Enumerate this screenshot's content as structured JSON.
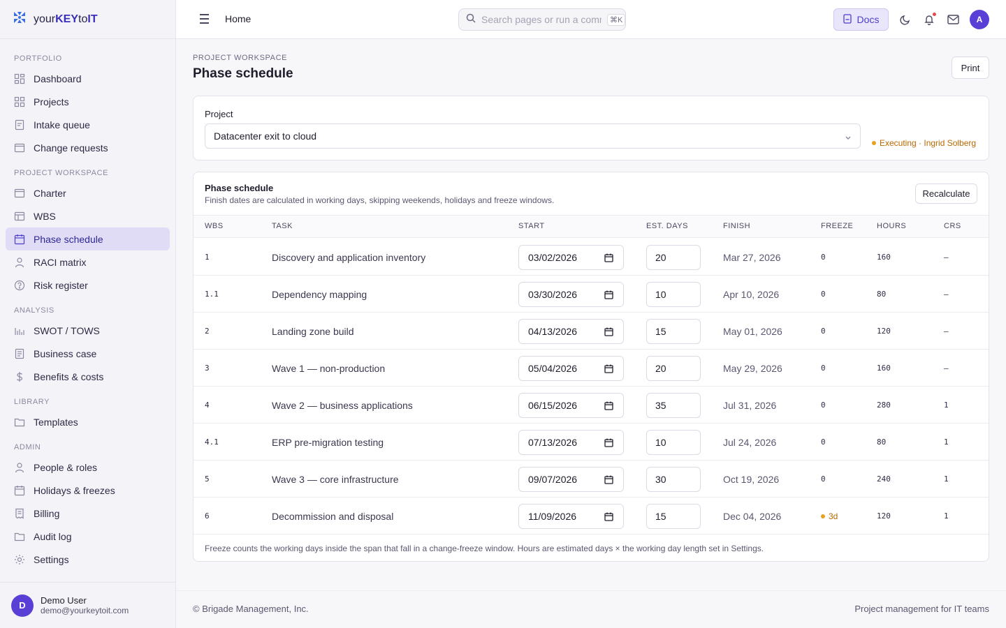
{
  "brand": {
    "prefix": "your",
    "key": "KEY",
    "to": "to",
    "it": "IT"
  },
  "sidebar": {
    "groups": [
      {
        "label": "PORTFOLIO",
        "items": [
          {
            "label": "Dashboard",
            "icon": "dashboard-icon"
          },
          {
            "label": "Projects",
            "icon": "grid-icon"
          },
          {
            "label": "Intake queue",
            "icon": "inbox-icon"
          },
          {
            "label": "Change requests",
            "icon": "window-icon"
          }
        ]
      },
      {
        "label": "PROJECT WORKSPACE",
        "items": [
          {
            "label": "Charter",
            "icon": "window-icon"
          },
          {
            "label": "WBS",
            "icon": "table-icon"
          },
          {
            "label": "Phase schedule",
            "icon": "calendar-icon",
            "active": true
          },
          {
            "label": "RACI matrix",
            "icon": "person-icon"
          },
          {
            "label": "Risk register",
            "icon": "help-circle-icon"
          }
        ]
      },
      {
        "label": "ANALYSIS",
        "items": [
          {
            "label": "SWOT / TOWS",
            "icon": "bar-chart-icon"
          },
          {
            "label": "Business case",
            "icon": "document-icon"
          },
          {
            "label": "Benefits & costs",
            "icon": "dollar-icon"
          }
        ]
      },
      {
        "label": "LIBRARY",
        "items": [
          {
            "label": "Templates",
            "icon": "folder-icon"
          }
        ]
      },
      {
        "label": "ADMIN",
        "items": [
          {
            "label": "People & roles",
            "icon": "person-icon"
          },
          {
            "label": "Holidays & freezes",
            "icon": "calendar-icon"
          },
          {
            "label": "Billing",
            "icon": "receipt-icon"
          },
          {
            "label": "Audit log",
            "icon": "folder-icon"
          },
          {
            "label": "Settings",
            "icon": "gear-icon"
          }
        ]
      }
    ]
  },
  "user": {
    "initial": "D",
    "name": "Demo User",
    "email": "demo@yourkeytoit.com"
  },
  "topbar": {
    "title": "Home",
    "search_placeholder": "Search pages or run a command",
    "shortcut": "⌘K",
    "docs_label": "Docs",
    "avatar_initial": "A"
  },
  "page": {
    "eyebrow": "PROJECT WORKSPACE",
    "title": "Phase schedule",
    "print_label": "Print"
  },
  "project": {
    "label": "Project",
    "selected": "Datacenter exit to cloud",
    "status": "Executing · Ingrid Solberg"
  },
  "schedule": {
    "title": "Phase schedule",
    "subtitle": "Finish dates are calculated in working days, skipping weekends, holidays and freeze windows.",
    "recalc_label": "Recalculate",
    "columns": [
      "WBS",
      "TASK",
      "START",
      "EST. DAYS",
      "FINISH",
      "FREEZE",
      "HOURS",
      "CRS"
    ],
    "rows": [
      {
        "wbs": "1",
        "task": "Discovery and application inventory",
        "start": "03/02/2026",
        "days": "20",
        "finish": "Mar 27, 2026",
        "freeze": "0",
        "hours": "160",
        "crs": "–"
      },
      {
        "wbs": "1.1",
        "task": "Dependency mapping",
        "start": "03/30/2026",
        "days": "10",
        "finish": "Apr 10, 2026",
        "freeze": "0",
        "hours": "80",
        "crs": "–"
      },
      {
        "wbs": "2",
        "task": "Landing zone build",
        "start": "04/13/2026",
        "days": "15",
        "finish": "May 01, 2026",
        "freeze": "0",
        "hours": "120",
        "crs": "–"
      },
      {
        "wbs": "3",
        "task": "Wave 1 — non-production",
        "start": "05/04/2026",
        "days": "20",
        "finish": "May 29, 2026",
        "freeze": "0",
        "hours": "160",
        "crs": "–"
      },
      {
        "wbs": "4",
        "task": "Wave 2 — business applications",
        "start": "06/15/2026",
        "days": "35",
        "finish": "Jul 31, 2026",
        "freeze": "0",
        "hours": "280",
        "crs": "1"
      },
      {
        "wbs": "4.1",
        "task": "ERP pre-migration testing",
        "start": "07/13/2026",
        "days": "10",
        "finish": "Jul 24, 2026",
        "freeze": "0",
        "hours": "80",
        "crs": "1"
      },
      {
        "wbs": "5",
        "task": "Wave 3 — core infrastructure",
        "start": "09/07/2026",
        "days": "30",
        "finish": "Oct 19, 2026",
        "freeze": "0",
        "hours": "240",
        "crs": "1"
      },
      {
        "wbs": "6",
        "task": "Decommission and disposal",
        "start": "11/09/2026",
        "days": "15",
        "finish": "Dec 04, 2026",
        "freeze": "3d",
        "freeze_warn": true,
        "hours": "120",
        "crs": "1"
      }
    ],
    "footnote": "Freeze counts the working days inside the span that fall in a change-freeze window. Hours are estimated days × the working day length set in Settings."
  },
  "footer": {
    "left": "© Brigade Management, Inc.",
    "right": "Project management for IT teams"
  }
}
